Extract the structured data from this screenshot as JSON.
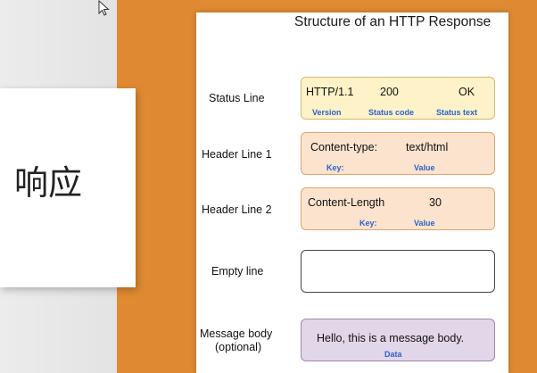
{
  "slide": {
    "kanji": "响应"
  },
  "diagram": {
    "title": "Structure of an HTTP Response",
    "rows": {
      "status": {
        "label": "Status Line",
        "version": "HTTP/1.1",
        "code": "200",
        "text": "OK",
        "version_key": "Version",
        "code_key": "Status code",
        "text_key": "Status text"
      },
      "header1": {
        "label": "Header Line 1",
        "name": "Content-type:",
        "value": "text/html",
        "name_key": "Key:",
        "value_key": "Value"
      },
      "header2": {
        "label": "Header Line 2",
        "name": "Content-Length",
        "value": "30",
        "name_key": "Key:",
        "value_key": "Value"
      },
      "empty": {
        "label": "Empty line"
      },
      "body": {
        "label_line1": "Message body",
        "label_line2": "(optional)",
        "content": "Hello, this is a message body.",
        "content_key": "Data"
      }
    }
  },
  "colors": {
    "orange_background": "#df8a32",
    "key_text": "#2d63c8",
    "status_box": "#fdf2c8",
    "header_box": "#fbe3cd",
    "body_box": "#e2d6e9"
  },
  "icons": {
    "cursor": "mouse-pointer-icon"
  }
}
